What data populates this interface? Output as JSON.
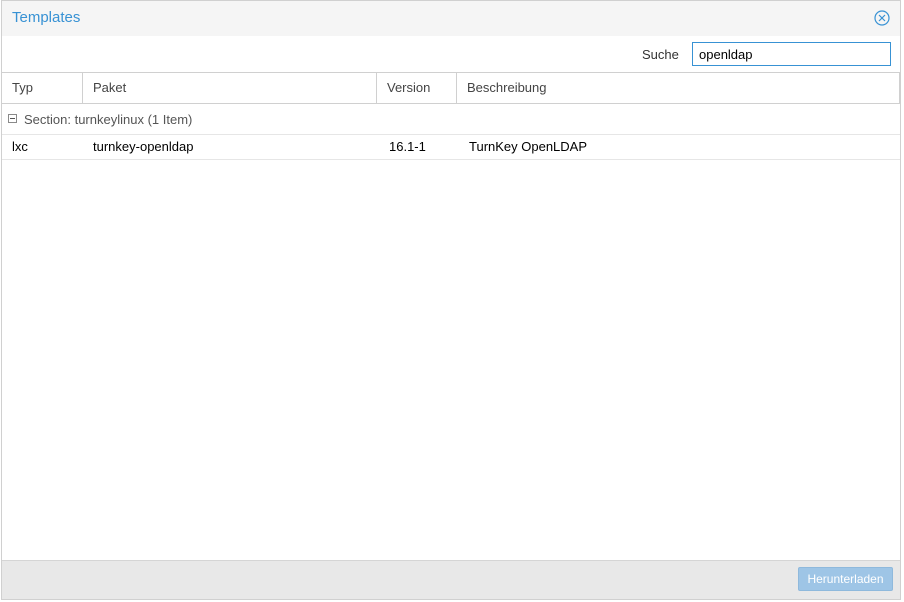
{
  "window": {
    "title": "Templates",
    "close_icon": "close-circle-icon"
  },
  "search": {
    "label": "Suche",
    "value": "openldap"
  },
  "grid": {
    "columns": [
      "Typ",
      "Paket",
      "Version",
      "Beschreibung"
    ],
    "group": {
      "label": "Section: turnkeylinux (1 Item)"
    },
    "rows": [
      {
        "typ": "lxc",
        "paket": "turnkey-openldap",
        "version": "16.1-1",
        "beschreibung": "TurnKey OpenLDAP"
      }
    ]
  },
  "footer": {
    "download_label": "Herunterladen"
  },
  "colors": {
    "accent": "#3892d4",
    "button_disabled": "#9ec5e6"
  }
}
